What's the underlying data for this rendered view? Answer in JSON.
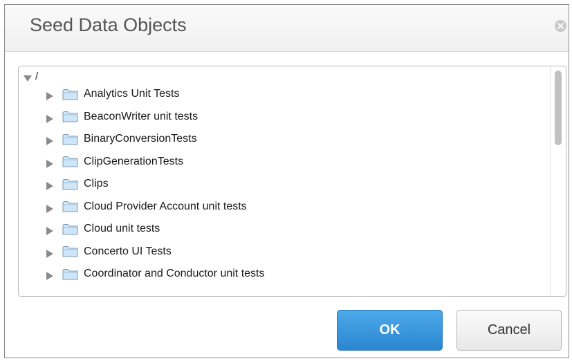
{
  "dialog": {
    "title": "Seed Data Objects",
    "close_icon": "close-icon"
  },
  "tree": {
    "root_label": "/",
    "root_expanded": true,
    "items": [
      {
        "label": "Analytics Unit Tests"
      },
      {
        "label": "BeaconWriter unit tests"
      },
      {
        "label": "BinaryConversionTests"
      },
      {
        "label": "ClipGenerationTests"
      },
      {
        "label": "Clips"
      },
      {
        "label": "Cloud Provider Account unit tests"
      },
      {
        "label": "Cloud unit tests"
      },
      {
        "label": "Concerto UI Tests"
      },
      {
        "label": "Coordinator and Conductor unit tests"
      }
    ],
    "icons": {
      "collapsed": "triangle-right-icon",
      "expanded": "triangle-down-icon",
      "folder": "folder-icon"
    }
  },
  "buttons": {
    "ok_label": "OK",
    "cancel_label": "Cancel"
  },
  "colors": {
    "ok_button": "#2a86d0",
    "cancel_button": "#e8e8e8",
    "folder_fill": "#cfe6f8",
    "title_text": "#555555"
  }
}
